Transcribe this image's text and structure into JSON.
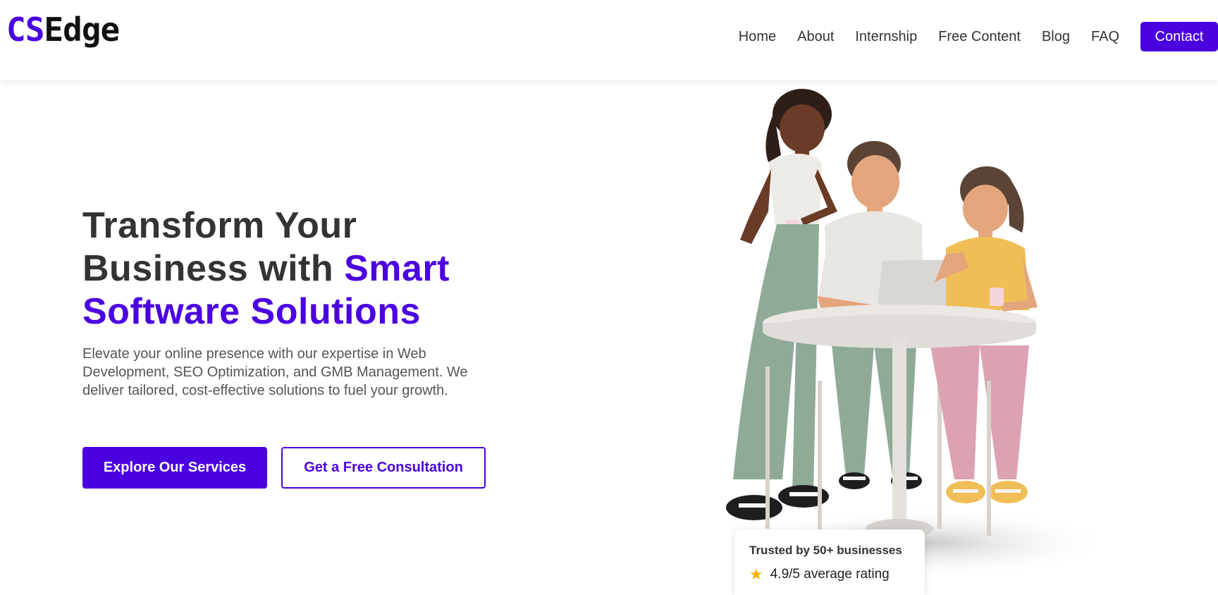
{
  "logo": {
    "accent": "CS",
    "rest": "Edge"
  },
  "nav": {
    "items": [
      "Home",
      "About",
      "Internship",
      "Free Content",
      "Blog",
      "FAQ"
    ],
    "contact": "Contact"
  },
  "hero": {
    "title_line1": "Transform Your",
    "title_line2_plain": "Business with ",
    "title_line2_highlight": "Smart",
    "title_line3_highlight": "Software Solutions",
    "description": "Elevate your online presence with our expertise in Web Development, SEO Optimization, and GMB Management. We deliver tailored, cost-effective solutions to fuel your growth.",
    "primary_button": "Explore Our Services",
    "secondary_button": "Get a Free Consultation"
  },
  "trust": {
    "title": "Trusted by 50+ businesses",
    "star_icon": "★",
    "rating": "4.9/5 average rating"
  },
  "colors": {
    "brand": "#4b00e0",
    "text_dark": "#333333",
    "text_muted": "#555555",
    "star": "#f4b400"
  },
  "icons": {
    "illustration": "three-people-at-table-with-laptop"
  }
}
